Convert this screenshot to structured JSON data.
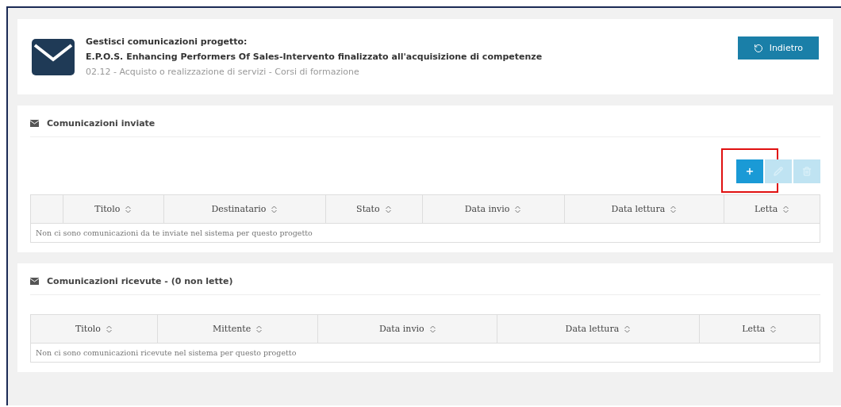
{
  "header": {
    "title": "Gestisci comunicazioni progetto:",
    "project": "E.P.O.S. Enhancing Performers Of Sales-Intervento finalizzato all'acquisizione di competenze",
    "subtitle": "02.12 - Acquisto o realizzazione di servizi - Corsi di formazione",
    "back_button": "Indietro"
  },
  "sent": {
    "title": "Comunicazioni inviate",
    "toolbar": [
      {
        "kind": "add",
        "disabled": false,
        "highlighted": true
      },
      {
        "kind": "edit",
        "disabled": true,
        "highlighted": false
      },
      {
        "kind": "delete",
        "disabled": true,
        "highlighted": false
      }
    ],
    "select_column": true,
    "columns": [
      "Titolo",
      "Destinatario",
      "Stato",
      "Data invio",
      "Data lettura",
      "Letta"
    ],
    "empty": "Non ci sono comunicazioni da te inviate nel sistema per questo progetto"
  },
  "received": {
    "title": "Comunicazioni ricevute - (0 non lette)",
    "select_column": false,
    "columns": [
      "Titolo",
      "Mittente",
      "Data invio",
      "Data lettura",
      "Letta"
    ],
    "empty": "Non ci sono comunicazioni ricevute nel sistema per questo progetto"
  }
}
